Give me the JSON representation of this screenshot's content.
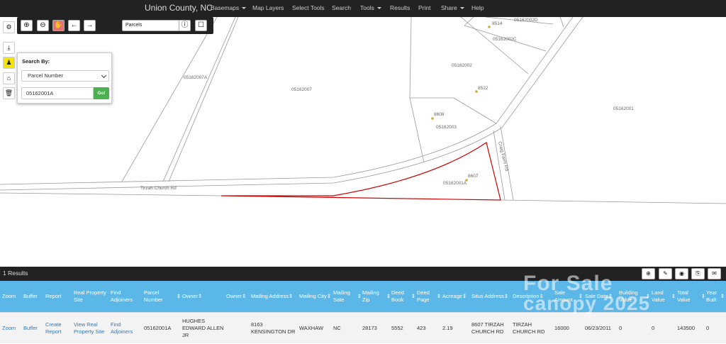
{
  "nav": {
    "brand": "Union County, NC",
    "items": [
      {
        "label": "Basemaps",
        "dropdown": true
      },
      {
        "label": "Map Layers",
        "dropdown": false
      },
      {
        "label": "Select Tools",
        "dropdown": false
      },
      {
        "label": "Search",
        "dropdown": false
      },
      {
        "label": "Tools",
        "dropdown": true
      },
      {
        "label": "Results",
        "dropdown": false
      },
      {
        "label": "Print",
        "dropdown": false
      },
      {
        "label": "Share",
        "dropdown": true
      },
      {
        "label": "Help",
        "dropdown": false
      }
    ]
  },
  "toolbar": {
    "layer_select": "Parcels",
    "buttons": [
      "zoom-in-icon",
      "zoom-out-icon",
      "pan-hand-icon",
      "arrow-left-icon",
      "arrow-right-icon",
      "info-icon",
      "square-icon"
    ]
  },
  "side_buttons": [
    "gear-icon",
    "download-icon",
    "binoculars-icon",
    "home-icon",
    "trash-icon"
  ],
  "search": {
    "title": "Search By:",
    "select_value": "Parcel Number",
    "input_value": "05162001A",
    "go_label": "Go!"
  },
  "map": {
    "labels": {
      "p1": "05162007A",
      "p2": "05162007",
      "p3": "05162002",
      "p4": "05162002C",
      "p5": "05162002D",
      "p6": "05162003",
      "p7": "05162001",
      "p8": "05162001A",
      "a1": "8514",
      "a2": "8522",
      "a3": "8608",
      "a4": "8607",
      "road1": "Tirzah Church Rd",
      "road2": "Craig Farm Rd"
    },
    "highlight_color": "#cc0000"
  },
  "results": {
    "count_text": "1 Results",
    "buttons": [
      "zoom-in-icon",
      "measure-icon",
      "target-icon",
      "export-icon",
      "email-icon"
    ],
    "columns": [
      {
        "label": "Zoom",
        "sort": false
      },
      {
        "label": "Buffer",
        "sort": false
      },
      {
        "label": "Report",
        "sort": false
      },
      {
        "label": "Real Property Site",
        "sort": false
      },
      {
        "label": "Find Adjoiners",
        "sort": false
      },
      {
        "label": "Parcel Number",
        "sort": true
      },
      {
        "label": "Owner",
        "sort": true
      },
      {
        "label": "Owner",
        "sort": true
      },
      {
        "label": "Mailing Address",
        "sort": true
      },
      {
        "label": "Mailing City",
        "sort": true
      },
      {
        "label": "Mailing Sate",
        "sort": true
      },
      {
        "label": "Mailing Zip",
        "sort": true
      },
      {
        "label": "Deed Book",
        "sort": true
      },
      {
        "label": "Deed Page",
        "sort": true
      },
      {
        "label": "Acreage",
        "sort": true
      },
      {
        "label": "Situs Address",
        "sort": true
      },
      {
        "label": "Description",
        "sort": true
      },
      {
        "label": "Sale Amount",
        "sort": true
      },
      {
        "label": "Sale Date",
        "sort": true
      },
      {
        "label": "Building Value",
        "sort": true
      },
      {
        "label": "Land Value",
        "sort": true
      },
      {
        "label": "Total Value",
        "sort": true
      },
      {
        "label": "Year Built",
        "sort": true
      }
    ],
    "row": [
      "Zoom",
      "Buffer",
      "Create Report",
      "View Real Property Site",
      "Find Adjoiners",
      "05162001A",
      "HUGHES EDWARD ALLEN JR",
      "",
      "8163 KENSINGTON DR",
      "WAXHAW",
      "NC",
      "28173",
      "5552",
      "423",
      "2.19",
      "8607 TIRZAH CHURCH RD",
      "TIRZAH CHURCH RD",
      "16000",
      "06/23/2011",
      "0",
      "0",
      "143500",
      "0"
    ]
  },
  "watermark": {
    "line1": "For Sale",
    "line2": "canopy 2025"
  }
}
